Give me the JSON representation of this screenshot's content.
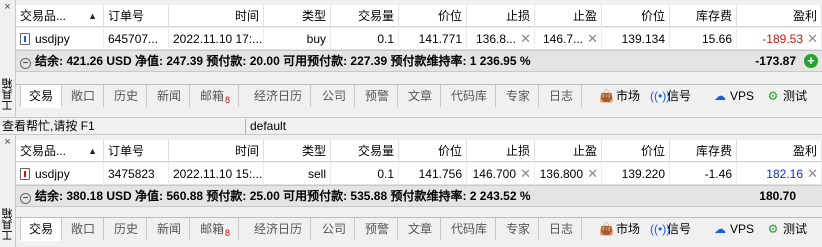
{
  "toolbox_label": "工具箱",
  "status_bar": {
    "help": "查看帮忙,请按 F1",
    "profile": "default"
  },
  "columns": {
    "symbol": "交易品...",
    "order": "订单号",
    "time": "时间",
    "type": "类型",
    "volume": "交易量",
    "price": "价位",
    "sl": "止损",
    "tp": "止盈",
    "current_price": "价位",
    "swap": "库存费",
    "profit": "盈利"
  },
  "tabs": [
    "交易",
    "敞口",
    "历史",
    "新闻",
    "邮箱",
    "经济日历",
    "公司",
    "预警",
    "文章",
    "代码库",
    "专家",
    "日志"
  ],
  "mailbox_badge": "8",
  "right_tabs": [
    {
      "label": "市场",
      "icon": "market-bag-icon"
    },
    {
      "label": "信号",
      "icon": "signal-icon"
    },
    {
      "label": "VPS",
      "icon": "cloud-icon"
    },
    {
      "label": "测试",
      "icon": "tester-icon"
    }
  ],
  "panels": [
    {
      "row": {
        "symbol": "usdjpy",
        "order": "645707...",
        "time": "2022.11.10 17:...",
        "type": "buy",
        "volume": "0.1",
        "price": "141.771",
        "sl": "136.8...",
        "tp": "146.7...",
        "current_price": "139.134",
        "swap": "15.66",
        "profit": "-189.53"
      },
      "summary": "结余: 421.26 USD  净值: 247.39  预付款: 20.00  可用预付款: 227.39  预付款维持率: 1 236.95 %",
      "total": "-173.87"
    },
    {
      "row": {
        "symbol": "usdjpy",
        "order": "3475823",
        "time": "2022.11.10 15:...",
        "type": "sell",
        "volume": "0.1",
        "price": "141.756",
        "sl": "146.700",
        "tp": "136.800",
        "current_price": "139.220",
        "swap": "-1.46",
        "profit": "182.16"
      },
      "summary": "结余: 380.18 USD  净值: 560.88  预付款: 25.00  可用预付款: 535.88  预付款维持率: 2 243.52 %",
      "total": "180.70"
    }
  ],
  "colors": {
    "loss": "#d81010",
    "gain": "#1030c8",
    "buy_icon": "#1a5fd6",
    "sell_icon": "#d81010",
    "add_button": "#22a32a"
  }
}
